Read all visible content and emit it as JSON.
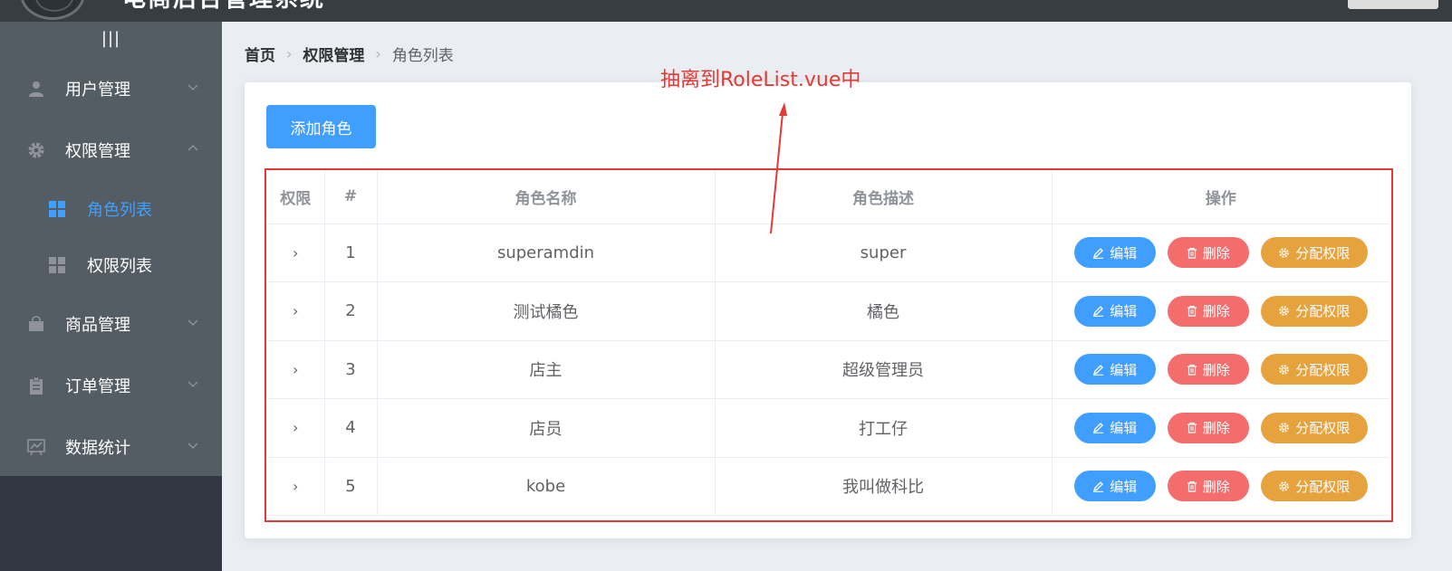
{
  "header": {
    "title": "电商后台管理系统"
  },
  "sidebar": {
    "toggle_label": "|||",
    "items": [
      {
        "label": "用户管理",
        "icon": "user-icon"
      },
      {
        "label": "权限管理",
        "icon": "gear-icon",
        "expanded": true,
        "children": [
          {
            "label": "角色列表",
            "active": true
          },
          {
            "label": "权限列表",
            "active": false
          }
        ]
      },
      {
        "label": "商品管理",
        "icon": "bag-icon"
      },
      {
        "label": "订单管理",
        "icon": "clipboard-icon"
      },
      {
        "label": "数据统计",
        "icon": "chart-icon"
      }
    ]
  },
  "breadcrumb": [
    "首页",
    "权限管理",
    "角色列表"
  ],
  "toolbar": {
    "add_role_label": "添加角色"
  },
  "table": {
    "columns": [
      "权限",
      "#",
      "角色名称",
      "角色描述",
      "操作"
    ],
    "rows": [
      {
        "index": "1",
        "name": "superamdin",
        "desc": "super"
      },
      {
        "index": "2",
        "name": "测试橘色",
        "desc": "橘色"
      },
      {
        "index": "3",
        "name": "店主",
        "desc": "超级管理员"
      },
      {
        "index": "4",
        "name": "店员",
        "desc": "打工仔"
      },
      {
        "index": "5",
        "name": "kobe",
        "desc": "我叫做科比"
      }
    ],
    "actions": {
      "edit": "编辑",
      "delete": "删除",
      "assign": "分配权限"
    }
  },
  "annotation": {
    "text": "抽离到RoleList.vue中"
  },
  "colors": {
    "primary": "#409eff",
    "danger": "#f56c6c",
    "warning": "#e6a23c",
    "annotation": "#e53935",
    "sidebar": "#545c64"
  }
}
